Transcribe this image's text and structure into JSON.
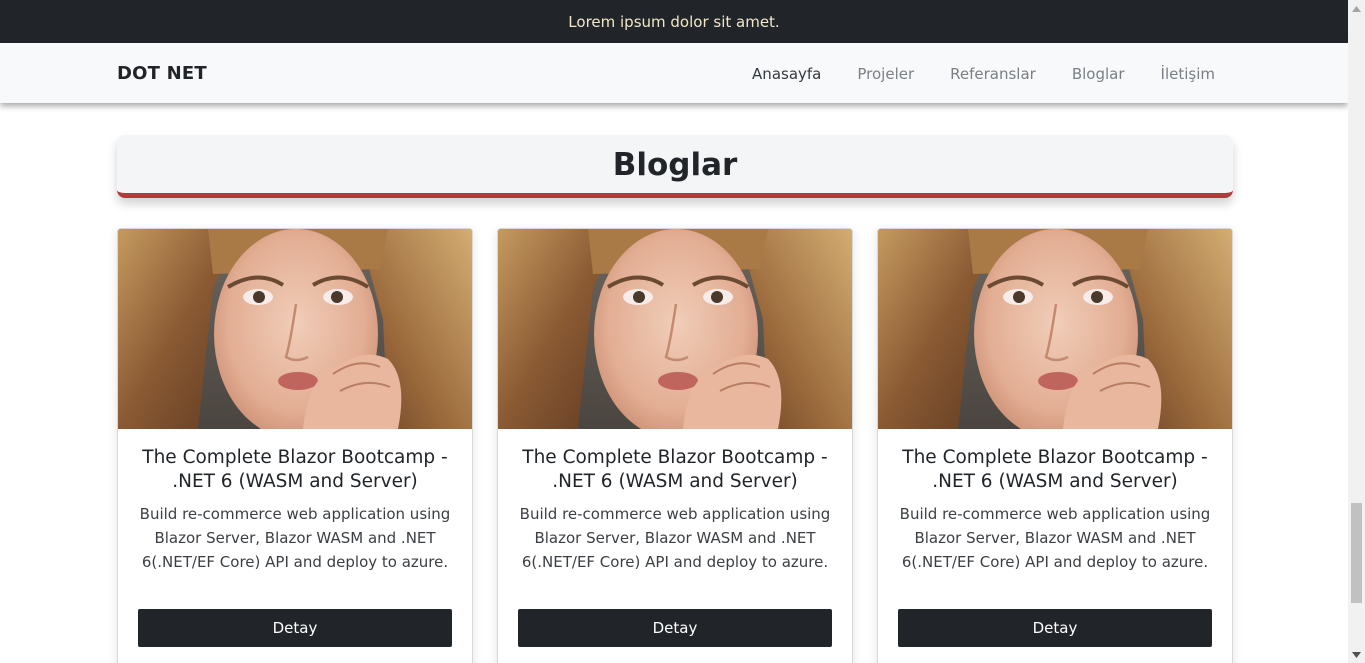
{
  "announcement": "Lorem ipsum dolor sit amet.",
  "navbar": {
    "brand": "DOT NET",
    "links": [
      {
        "label": "Anasayfa",
        "active": true
      },
      {
        "label": "Projeler",
        "active": false
      },
      {
        "label": "Referanslar",
        "active": false
      },
      {
        "label": "Bloglar",
        "active": false
      },
      {
        "label": "İletişim",
        "active": false
      }
    ]
  },
  "section": {
    "title": "Bloglar"
  },
  "cards": [
    {
      "title": "The Complete Blazor Bootcamp - .NET 6 (WASM and Server)",
      "text": "Build re-commerce web application using Blazor Server, Blazor WASM and .NET 6(.NET/EF Core) API and deploy to azure.",
      "button": "Detay"
    },
    {
      "title": "The Complete Blazor Bootcamp - .NET 6 (WASM and Server)",
      "text": "Build re-commerce web application using Blazor Server, Blazor WASM and .NET 6(.NET/EF Core) API and deploy to azure.",
      "button": "Detay"
    },
    {
      "title": "The Complete Blazor Bootcamp - .NET 6 (WASM and Server)",
      "text": "Build re-commerce web application using Blazor Server, Blazor WASM and .NET 6(.NET/EF Core) API and deploy to azure.",
      "button": "Detay"
    }
  ],
  "colors": {
    "topbar_bg": "#212529",
    "topbar_text": "#f1e6c8",
    "navbar_bg": "#f8f9fa",
    "accent_underline": "#b33a3a",
    "button_bg": "#212529"
  },
  "icons": {
    "scroll_up": "triangle-up-icon",
    "scroll_down": "triangle-down-icon",
    "card_image": "portrait-photo"
  }
}
